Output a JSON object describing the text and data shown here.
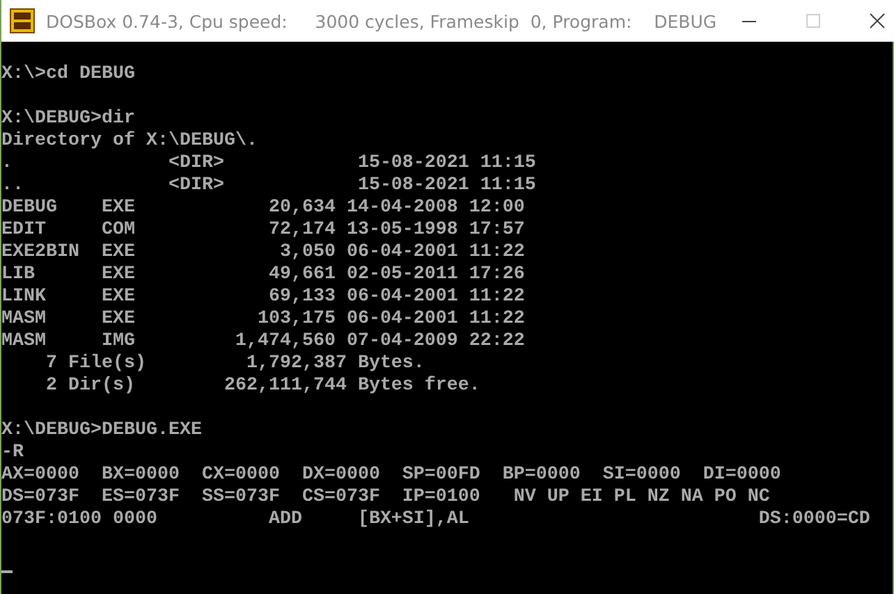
{
  "window": {
    "title": "DOSBox 0.74-3, Cpu speed:     3000 cycles, Frameskip  0, Program:    DEBUG",
    "maximize_disabled": true
  },
  "console": {
    "blocks": [
      [
        "X:\\>cd DEBUG"
      ],
      [
        "X:\\DEBUG>dir",
        "Directory of X:\\DEBUG\\.",
        ".              <DIR>            15-08-2021 11:15",
        "..             <DIR>            15-08-2021 11:15",
        "DEBUG    EXE            20,634 14-04-2008 12:00",
        "EDIT     COM            72,174 13-05-1998 17:57",
        "EXE2BIN  EXE             3,050 06-04-2001 11:22",
        "LIB      EXE            49,661 02-05-2011 17:26",
        "LINK     EXE            69,133 06-04-2001 11:22",
        "MASM     EXE           103,175 06-04-2001 11:22",
        "MASM     IMG         1,474,560 07-04-2009 22:22",
        "    7 File(s)         1,792,387 Bytes.",
        "    2 Dir(s)        262,111,744 Bytes free."
      ],
      [
        "X:\\DEBUG>DEBUG.EXE",
        "-R",
        "AX=0000  BX=0000  CX=0000  DX=0000  SP=00FD  BP=0000  SI=0000  DI=0000",
        "DS=073F  ES=073F  SS=073F  CS=073F  IP=0100   NV UP EI PL NZ NA PO NC",
        "073F:0100 0000          ADD     [BX+SI],AL                          DS:0000=CD"
      ]
    ],
    "cursor": true
  }
}
